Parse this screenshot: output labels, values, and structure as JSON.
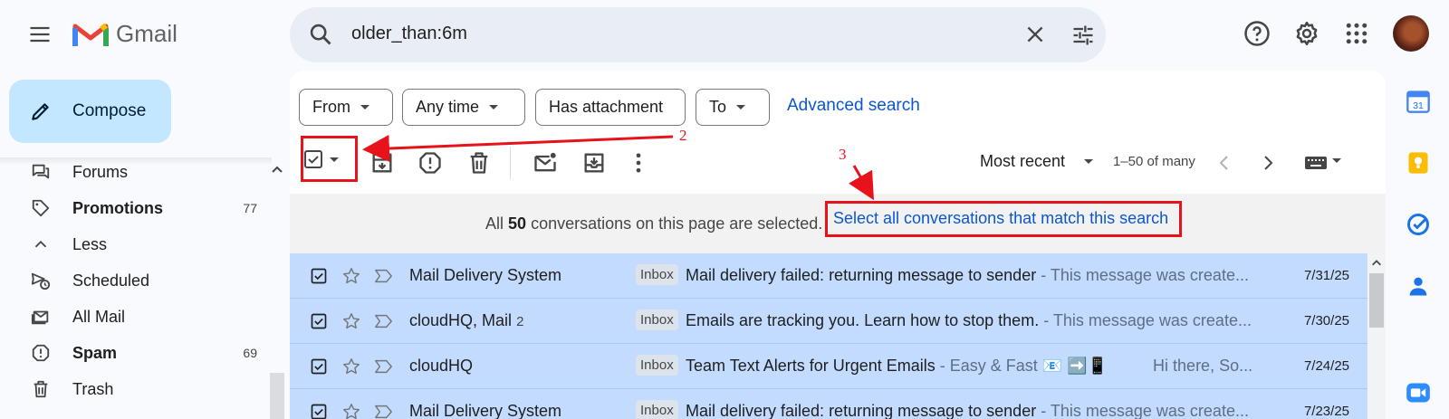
{
  "header": {
    "app_name": "Gmail",
    "search_query": "older_than:6m"
  },
  "compose": {
    "label": "Compose"
  },
  "sidebar": {
    "items": [
      {
        "label": "Forums",
        "count": "",
        "bold": false,
        "icon": "forum-icon"
      },
      {
        "label": "Promotions",
        "count": "77",
        "bold": true,
        "icon": "tag-icon"
      },
      {
        "label": "Less",
        "count": "",
        "bold": false,
        "icon": "chevron-up-icon"
      },
      {
        "label": "Scheduled",
        "count": "",
        "bold": false,
        "icon": "schedule-send-icon"
      },
      {
        "label": "All Mail",
        "count": "",
        "bold": false,
        "icon": "all-mail-icon"
      },
      {
        "label": "Spam",
        "count": "69",
        "bold": true,
        "icon": "spam-icon"
      },
      {
        "label": "Trash",
        "count": "",
        "bold": false,
        "icon": "trash-icon"
      }
    ]
  },
  "filters": {
    "chips": [
      "From",
      "Any time",
      "Has attachment",
      "To"
    ],
    "advanced_search": "Advanced search"
  },
  "toolbar": {
    "sort_label": "Most recent",
    "range_label": "1–50 of many"
  },
  "selection_banner": {
    "prefix": "All",
    "count": "50",
    "suffix": "conversations on this page are selected.",
    "link": "Select all conversations that match this search"
  },
  "annotations": {
    "arrow_2": "2",
    "arrow_3": "3"
  },
  "emails": [
    {
      "sender": "Mail Delivery System",
      "sender_count": "",
      "label": "Inbox",
      "subject": "Mail delivery failed: returning message to sender",
      "snippet": " - This message was create...",
      "date": "7/31/25"
    },
    {
      "sender": "cloudHQ, Mail",
      "sender_count": "2",
      "label": "Inbox",
      "subject": "Emails are tracking you. Learn how to stop them.",
      "snippet": " - This message was create...",
      "date": "7/30/25"
    },
    {
      "sender": "cloudHQ",
      "sender_count": "",
      "label": "Inbox",
      "subject": "Team Text Alerts for Urgent Emails",
      "snippet": " - Easy & Fast 📧 ➡️📱          Hi there, So...",
      "date": "7/24/25"
    },
    {
      "sender": "Mail Delivery System",
      "sender_count": "",
      "label": "Inbox",
      "subject": "Mail delivery failed: returning message to sender",
      "snippet": " - This message was create...",
      "date": "7/23/25"
    }
  ],
  "colors": {
    "accent_blue": "#0b57d0",
    "selected_row": "#c2dbff",
    "annotation_red": "#e8121a",
    "compose_bg": "#c2e7ff"
  }
}
